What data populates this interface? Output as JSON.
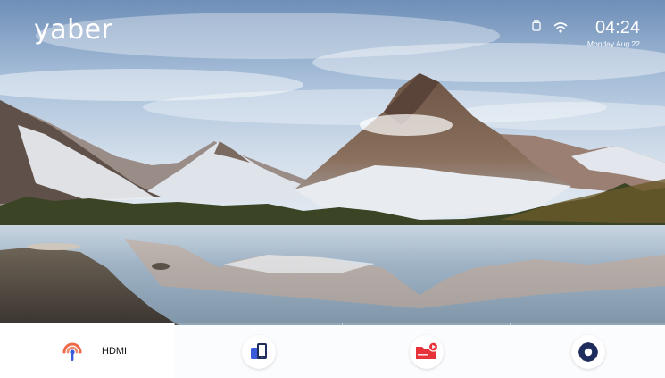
{
  "header": {
    "logo_text": "yaber",
    "status_icons": [
      "usb-drive-icon",
      "wifi-icon"
    ],
    "time": "04:24",
    "date": "Monday Aug 22"
  },
  "dock": {
    "items": [
      {
        "label": "HDMI",
        "icon": "hdmi-signal-icon",
        "selected": true
      },
      {
        "label": "",
        "icon": "screen-mirror-icon",
        "selected": false
      },
      {
        "label": "",
        "icon": "media-player-icon",
        "selected": false
      },
      {
        "label": "",
        "icon": "settings-gear-icon",
        "selected": false
      }
    ]
  },
  "colors": {
    "accent_red": "#e8323a",
    "accent_blue": "#3b5bdb",
    "icon_dark": "#1f2d5c",
    "hdmi_orange": "#f06a4a"
  }
}
